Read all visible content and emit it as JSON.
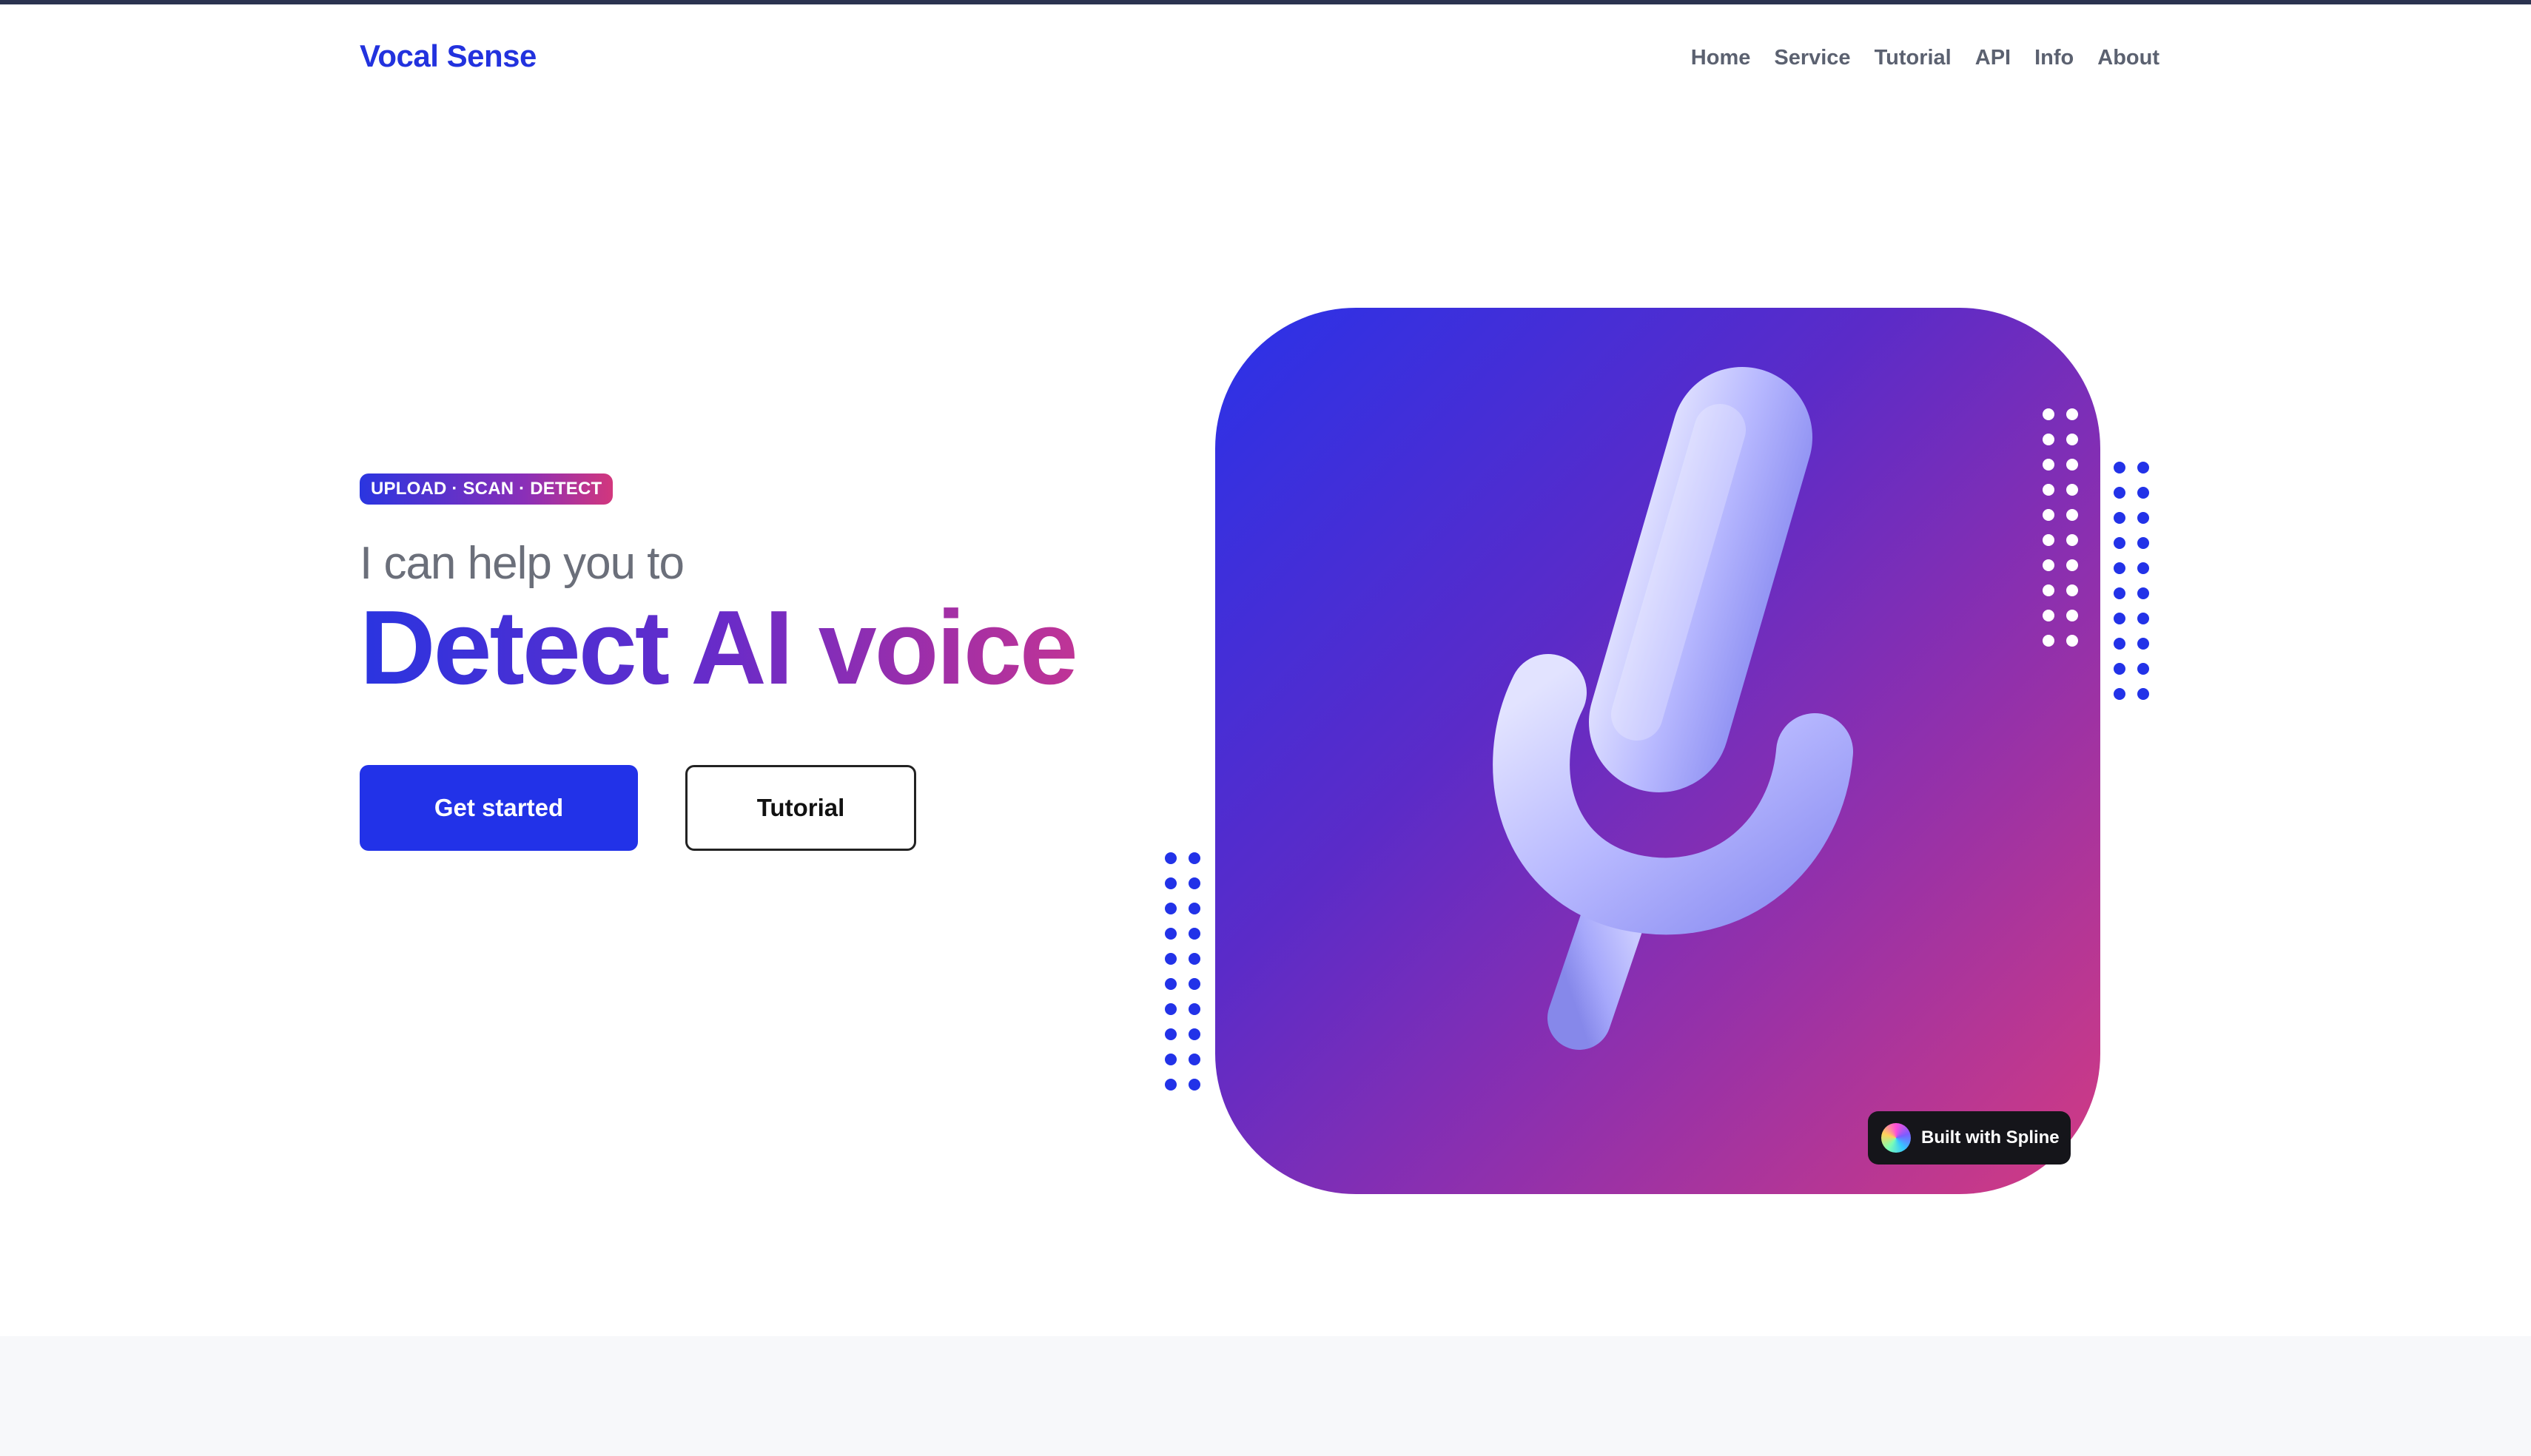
{
  "header": {
    "brand": "Vocal Sense",
    "nav": [
      {
        "label": "Home"
      },
      {
        "label": "Service"
      },
      {
        "label": "Tutorial"
      },
      {
        "label": "API"
      },
      {
        "label": "Info"
      },
      {
        "label": "About"
      }
    ]
  },
  "hero": {
    "badge": "UPLOAD · SCAN · DETECT",
    "subtitle": "I can help you to",
    "headline": "Detect AI voice",
    "primary_button": "Get started",
    "secondary_button": "Tutorial",
    "visual_icon": "microphone-3d-icon"
  },
  "spline_badge": {
    "text": "Built with Spline",
    "icon": "spline-logo-icon"
  },
  "colors": {
    "brand": "#2232de",
    "primary_button": "#2232e8",
    "gradient_start": "#2a32e8",
    "gradient_mid": "#8a2fb0",
    "gradient_end": "#d33b82",
    "dot_blue": "#2232e8",
    "dot_white": "#ffffff",
    "footer_band": "#f7f8fa"
  }
}
